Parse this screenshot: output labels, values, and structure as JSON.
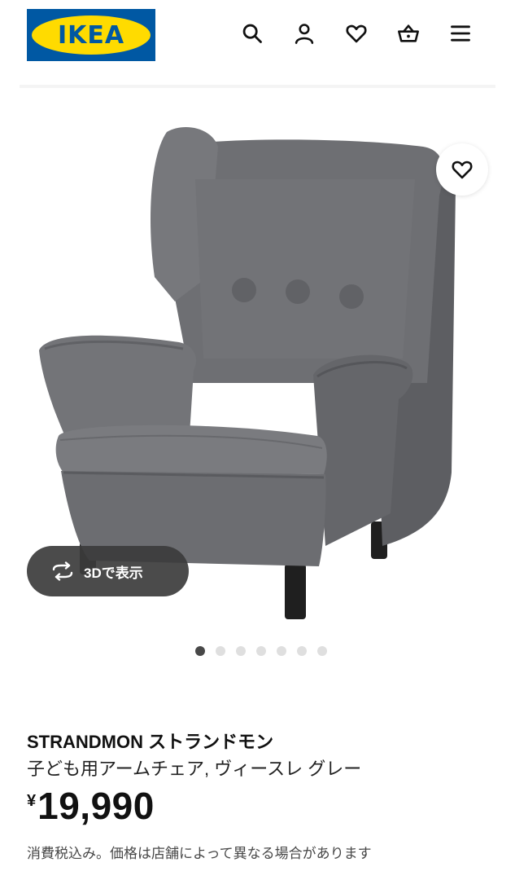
{
  "header": {
    "logo_text": "IKEA",
    "icons": [
      "search-icon",
      "account-icon",
      "heart-icon",
      "basket-icon",
      "menu-icon"
    ]
  },
  "gallery": {
    "view_3d_label": "3Dで表示",
    "total_images": 7,
    "active_image": 1
  },
  "product": {
    "name": "STRANDMON ストランドモン",
    "description": "子ども用アームチェア, ヴィースレ グレー",
    "currency": "¥",
    "price": "19,990",
    "tax_note": "消費税込み。価格は店舗によって異なる場合があります"
  },
  "colors": {
    "ikea_blue": "#0058a3",
    "ikea_yellow": "#ffdb00",
    "chair_gray": "#6e6f73"
  }
}
